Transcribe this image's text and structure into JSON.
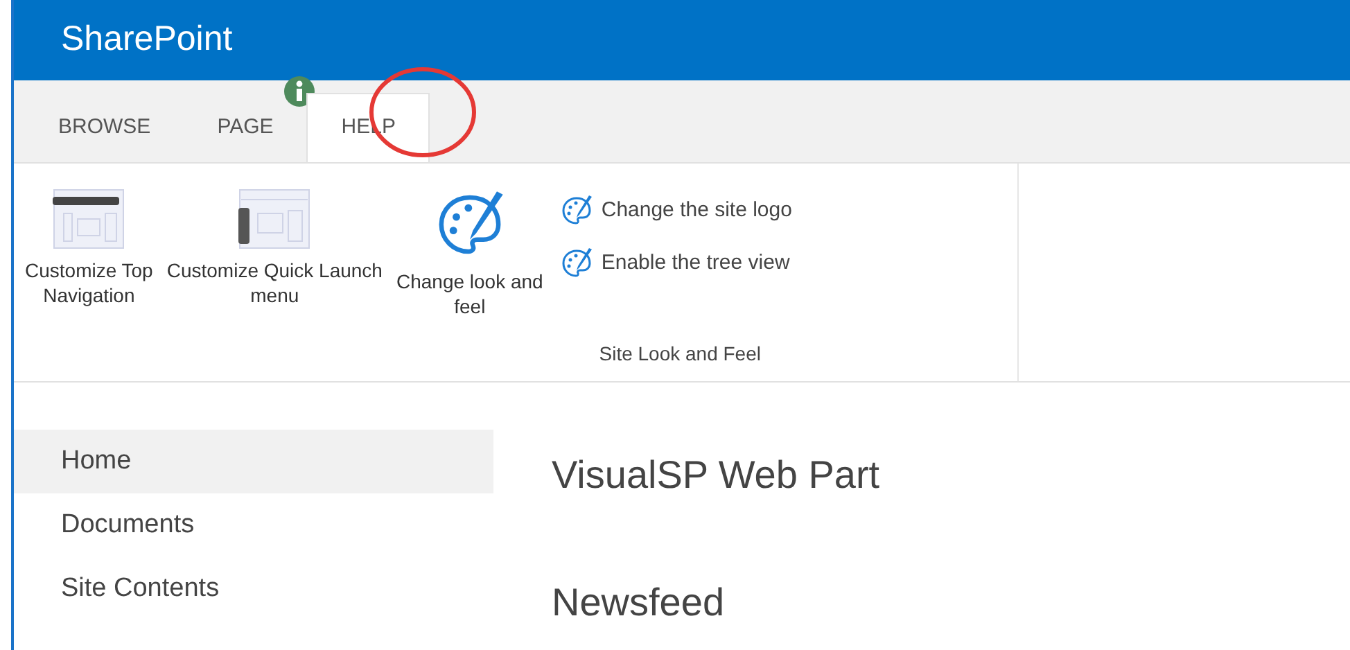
{
  "header": {
    "title": "SharePoint"
  },
  "tabs": [
    {
      "label": "BROWSE",
      "selected": false,
      "badge": false
    },
    {
      "label": "PAGE",
      "selected": false,
      "badge": true
    },
    {
      "label": "HELP",
      "selected": true,
      "badge": false
    }
  ],
  "ribbon": {
    "large_buttons": [
      {
        "label": "Customize Top\nNavigation",
        "kind": "topnav"
      },
      {
        "label": "Customize Quick Launch\nmenu",
        "kind": "quicklaunch"
      },
      {
        "label": "Change look and\nfeel",
        "kind": "palette"
      }
    ],
    "small_buttons": [
      {
        "label": "Change the site logo"
      },
      {
        "label": "Enable the tree view"
      }
    ],
    "group_label": "Site Look and Feel"
  },
  "nav": [
    {
      "label": "Home",
      "selected": true
    },
    {
      "label": "Documents",
      "selected": false
    },
    {
      "label": "Site Contents",
      "selected": false
    }
  ],
  "content": {
    "headings": [
      "VisualSP Web Part",
      "Newsfeed"
    ]
  }
}
